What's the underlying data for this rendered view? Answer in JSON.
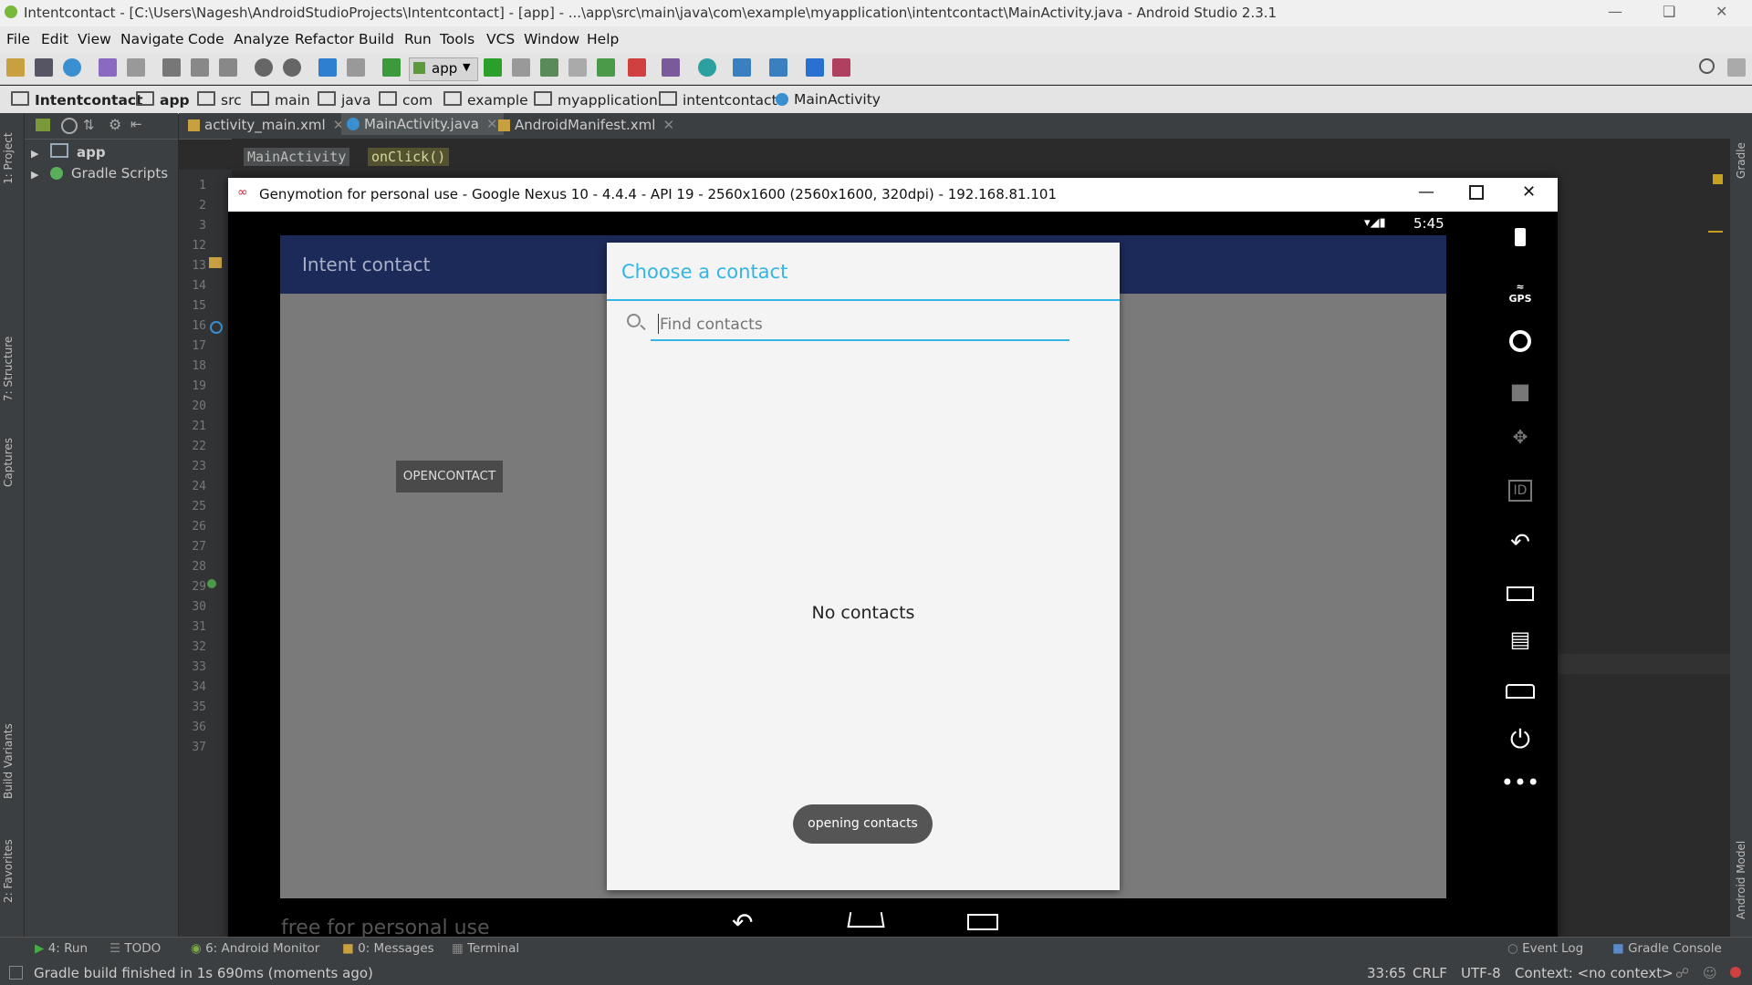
{
  "window": {
    "title": "Intentcontact - [C:\\Users\\Nagesh\\AndroidStudioProjects\\Intentcontact] - [app] - ...\\app\\src\\main\\java\\com\\example\\myapplication\\intentcontact\\MainActivity.java - Android Studio 2.3.1"
  },
  "menu": [
    "File",
    "Edit",
    "View",
    "Navigate",
    "Code",
    "Analyze",
    "Refactor",
    "Build",
    "Run",
    "Tools",
    "VCS",
    "Window",
    "Help"
  ],
  "toolbar": {
    "run_config": "app"
  },
  "breadcrumb": [
    "Intentcontact",
    "app",
    "src",
    "main",
    "java",
    "com",
    "example",
    "myapplication",
    "intentcontact",
    "MainActivity"
  ],
  "left_tabs": [
    "1: Project",
    "7: Structure",
    "Captures",
    "Build Variants",
    "2: Favorites"
  ],
  "right_tabs": [
    "Gradle",
    "Android Model"
  ],
  "project_tree": [
    "app",
    "Gradle Scripts"
  ],
  "editor_tabs": [
    "activity_main.xml",
    "MainActivity.java",
    "AndroidManifest.xml"
  ],
  "nav": [
    "MainActivity",
    "onClick()"
  ],
  "line_numbers": [
    "1",
    "2",
    "3",
    "12",
    "13",
    "14",
    "15",
    "16",
    "17",
    "18",
    "19",
    "20",
    "21",
    "22",
    "23",
    "24",
    "25",
    "26",
    "27",
    "28",
    "29",
    "30",
    "31",
    "32",
    "33",
    "34",
    "35",
    "36",
    "37"
  ],
  "emulator": {
    "title": "Genymotion for personal use - Google Nexus 10 - 4.4.4 - API 19 - 2560x1600 (2560x1600, 320dpi) - 192.168.81.101",
    "clock": "5:45",
    "app_title": "Intent contact",
    "button": "OPENCONTACT",
    "dialog_title": "Choose a contact",
    "search_placeholder": "Find contacts",
    "empty_text": "No contacts",
    "toast": "opening contacts",
    "watermark": "free for personal use",
    "side_labels": {
      "gps": "GPS",
      "id": "ID"
    }
  },
  "bottom_tools": [
    "4: Run",
    "TODO",
    "6: Android Monitor",
    "0: Messages",
    "Terminal",
    "Event Log",
    "Gradle Console"
  ],
  "status": {
    "message": "Gradle build finished in 1s 690ms (moments ago)",
    "position": "33:65",
    "line_sep": "CRLF",
    "encoding": "UTF-8",
    "context": "Context: <no context>"
  },
  "colors": {
    "accent": "#33b5e5",
    "app_bar": "#1c2a59",
    "ide_dark": "#2b2b2b"
  }
}
